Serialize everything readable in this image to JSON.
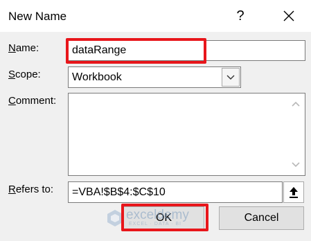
{
  "window": {
    "title": "New Name",
    "help_label": "?",
    "close_label": "✕"
  },
  "form": {
    "name_label_accel": "N",
    "name_label_rest": "ame:",
    "name_value": "dataRange",
    "scope_label_accel": "S",
    "scope_label_rest": "cope:",
    "scope_value": "Workbook",
    "comment_label_accel": "C",
    "comment_label_pre": "",
    "comment_label_rest": "omment:",
    "comment_value": "",
    "refers_label_accel": "R",
    "refers_label_rest": "efers to:",
    "refers_value": "=VBA!$B$4:$C$10"
  },
  "buttons": {
    "ok_label": "OK",
    "cancel_label": "Cancel"
  },
  "watermark": {
    "name": "exceldemy",
    "tagline": "EXCEL · DATA · BI"
  },
  "colors": {
    "highlight": "#e8161b",
    "watermark": "#7f9fc0"
  },
  "icons": [
    "help-icon",
    "close-icon",
    "chevron-down-icon",
    "scroll-up-icon",
    "scroll-down-icon",
    "collapse-dialog-icon",
    "exceldemy-logo-icon"
  ]
}
